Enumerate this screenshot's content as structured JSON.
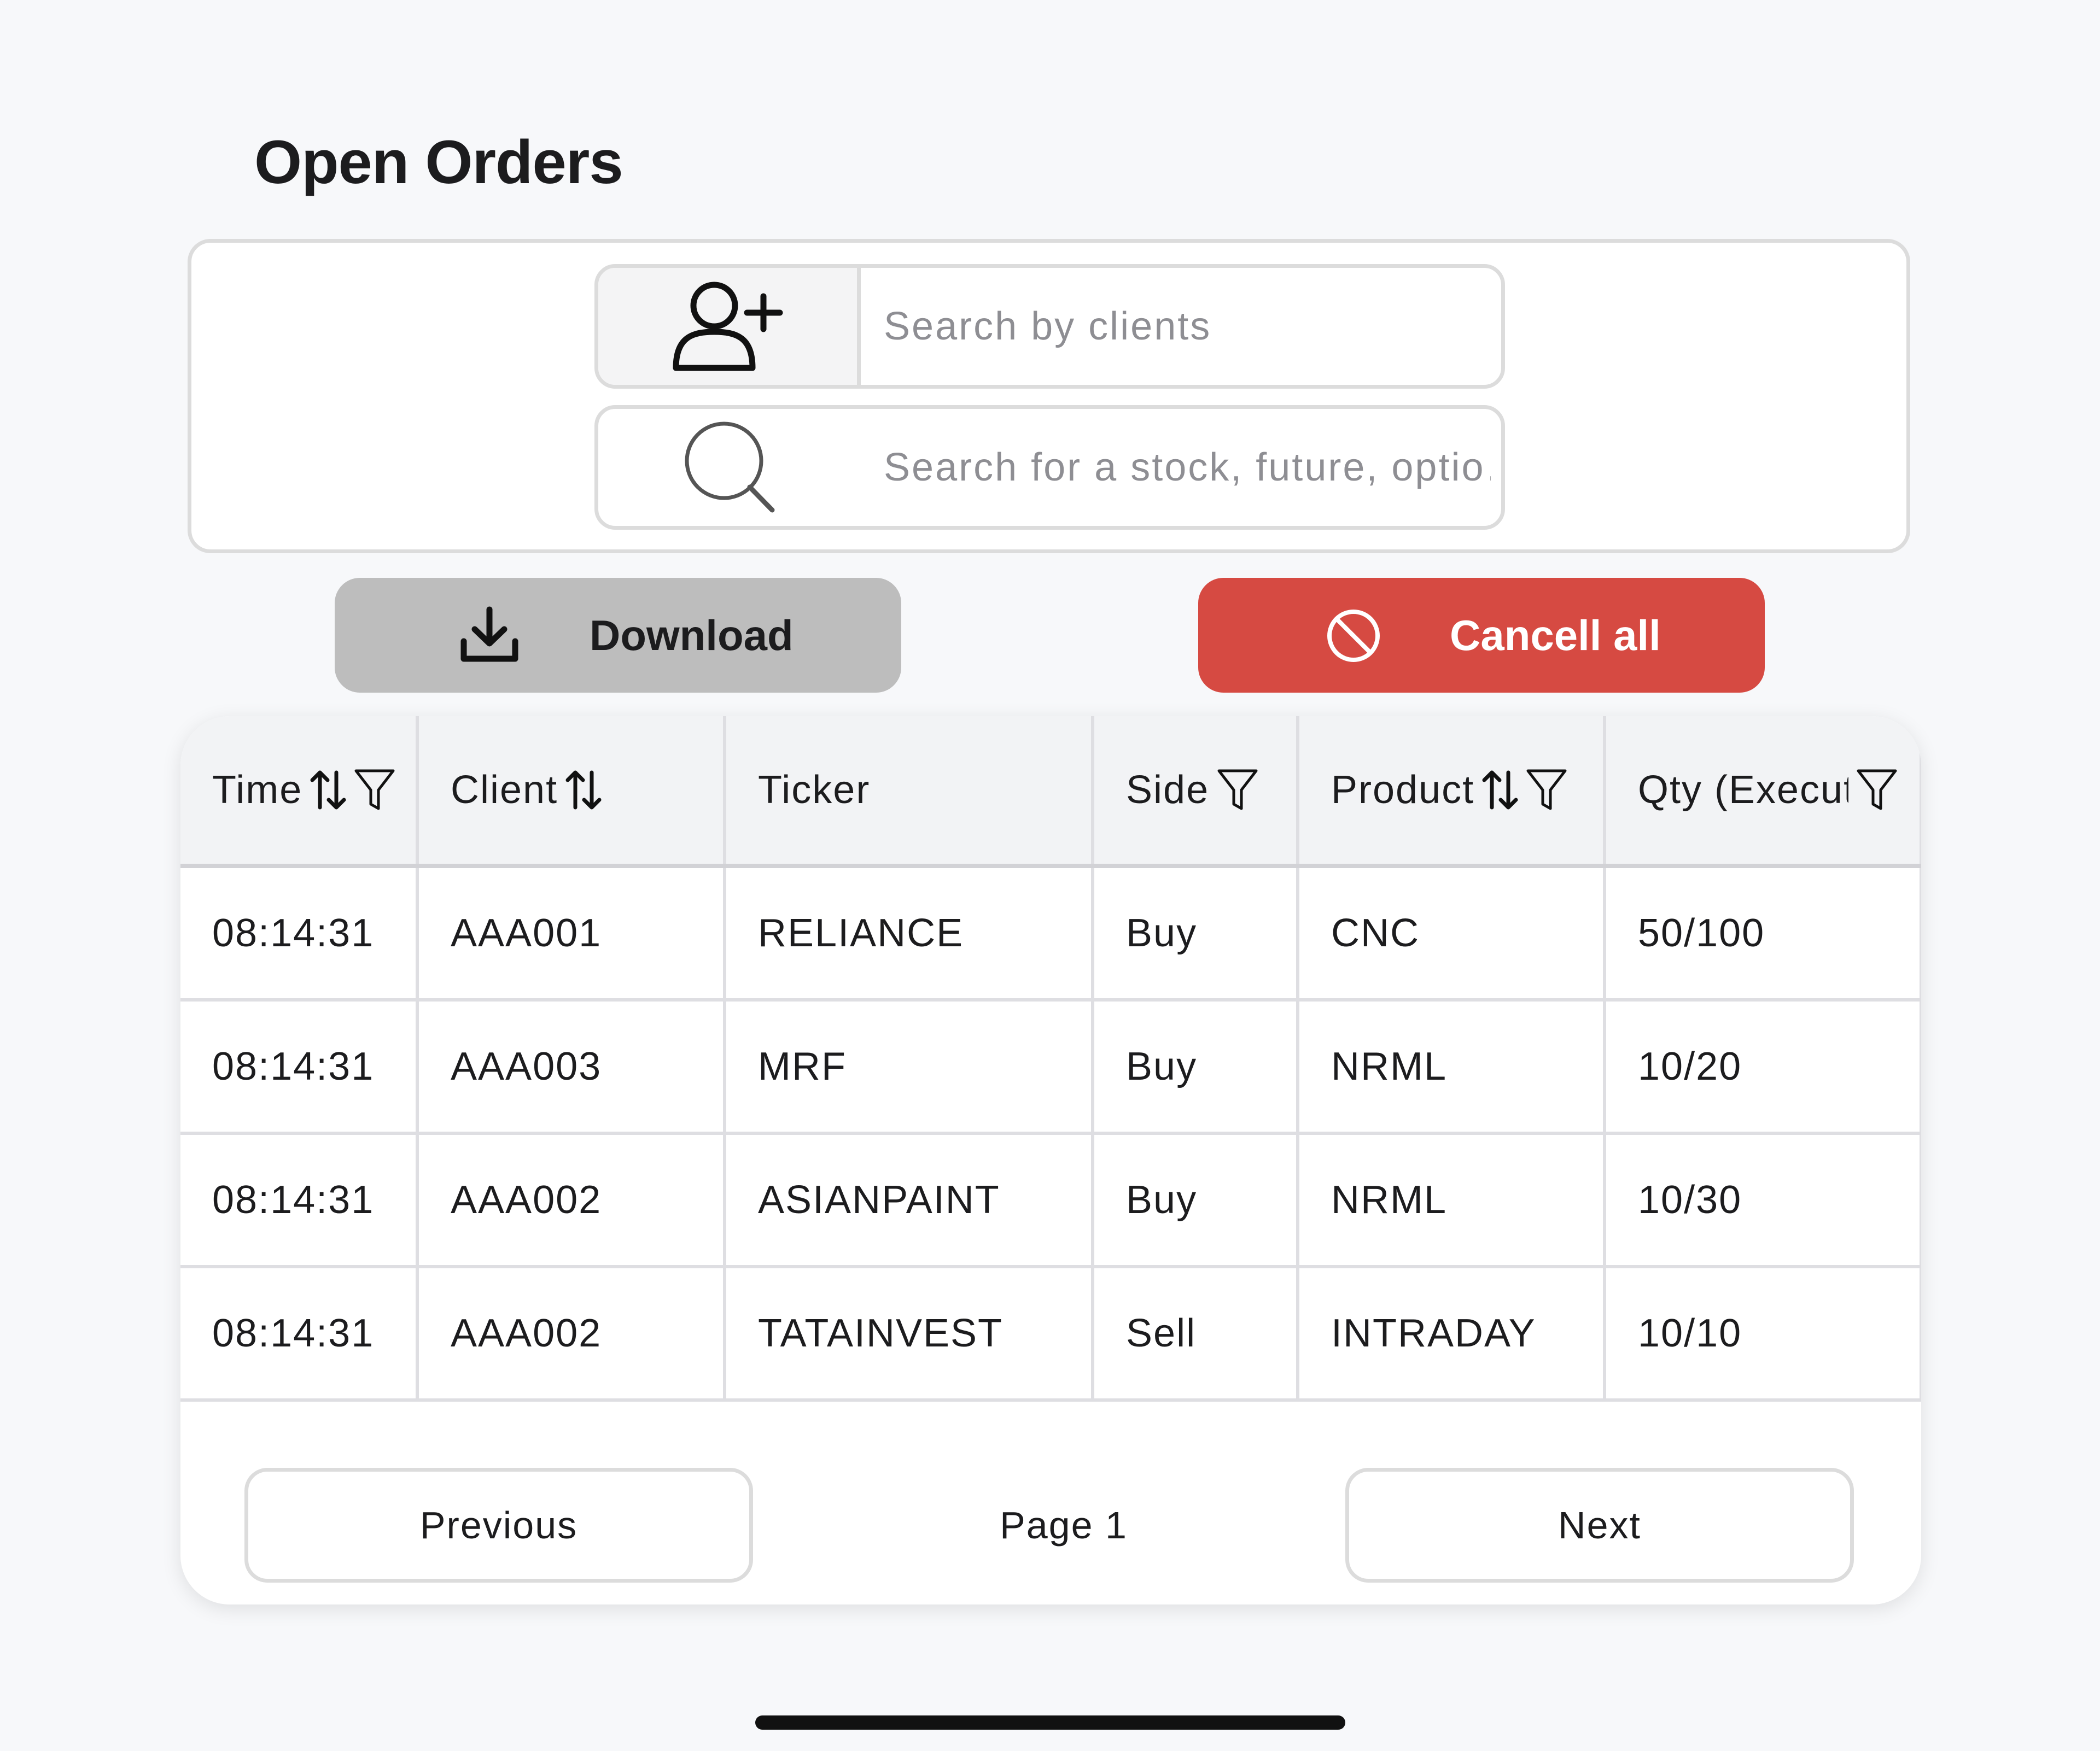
{
  "page": {
    "title": "Open Orders"
  },
  "search": {
    "client_placeholder": "Search by clients",
    "stock_placeholder": "Search for a stock, future, optio…",
    "client_icon": "user-plus-icon",
    "stock_icon": "search-icon"
  },
  "actions": {
    "download_label": "Download",
    "download_icon": "download-icon",
    "cancel_all_label": "Cancell all",
    "cancel_all_icon": "ban-icon",
    "cancel_color": "#d64a42",
    "download_color": "#bdbdbd"
  },
  "table": {
    "columns": [
      {
        "label": "Time",
        "sortable": true,
        "filterable": true
      },
      {
        "label": "Client",
        "sortable": true,
        "filterable": false
      },
      {
        "label": "Ticker",
        "sortable": false,
        "filterable": false
      },
      {
        "label": "Side",
        "sortable": false,
        "filterable": true
      },
      {
        "label": "Product",
        "sortable": true,
        "filterable": true
      },
      {
        "label": "Qty (Execute",
        "sortable": false,
        "filterable": true
      }
    ],
    "rows": [
      [
        "08:14:31",
        "AAA001",
        "RELIANCE",
        "Buy",
        "CNC",
        "50/100"
      ],
      [
        "08:14:31",
        "AAA003",
        "MRF",
        "Buy",
        "NRML",
        "10/20"
      ],
      [
        "08:14:31",
        "AAA002",
        "ASIANPAINT",
        "Buy",
        "NRML",
        "10/30"
      ],
      [
        "08:14:31",
        "AAA002",
        "TATAINVEST",
        "Sell",
        "INTRADAY",
        "10/10"
      ]
    ]
  },
  "pagination": {
    "previous_label": "Previous",
    "page_label": "Page 1",
    "next_label": "Next"
  }
}
